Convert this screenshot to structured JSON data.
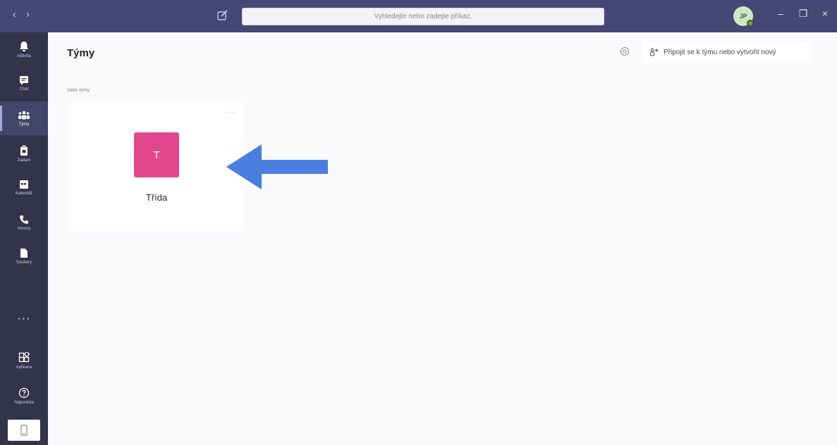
{
  "titlebar": {
    "search_placeholder": "Vyhledejte nebo zadejte příkaz.",
    "avatar_initials": "JP",
    "nav_back": "‹",
    "nav_forward": "›",
    "minimize": "–",
    "maximize": "❐",
    "close": "×"
  },
  "rail": {
    "items": [
      {
        "label": "Aktivita",
        "icon": "bell-icon"
      },
      {
        "label": "Chat",
        "icon": "chat-icon"
      },
      {
        "label": "Týmy",
        "icon": "teams-icon"
      },
      {
        "label": "Zadání",
        "icon": "assignments-icon"
      },
      {
        "label": "Kalendář",
        "icon": "calendar-icon"
      },
      {
        "label": "Hovory",
        "icon": "phone-icon"
      },
      {
        "label": "Soubory",
        "icon": "file-icon"
      }
    ],
    "more": "···",
    "apps_label": "Aplikace",
    "help_label": "Nápověda"
  },
  "main": {
    "title": "Týmy",
    "join_button": "Připojit se k týmu nebo vytvořit nový",
    "section_label": "Vaše týmy",
    "teams": [
      {
        "initial": "T",
        "name": "Třída",
        "more": "···"
      }
    ]
  },
  "colors": {
    "titlebar": "#464775",
    "rail": "#33344a",
    "team_avatar": "#e2468c",
    "annotation_arrow": "#4a7fe0"
  }
}
